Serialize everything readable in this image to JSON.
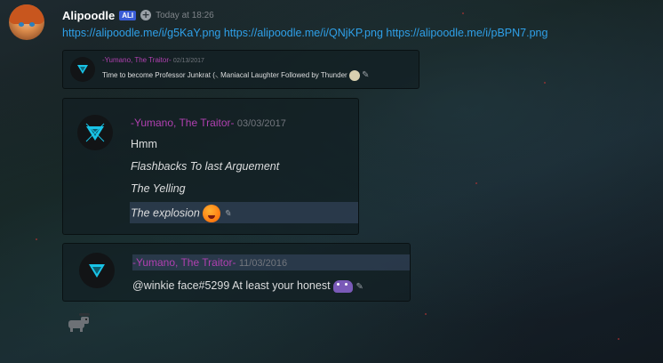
{
  "message": {
    "username": "Alipoodle",
    "badge": "ALI",
    "timestamp": "Today at 18:26",
    "links": [
      "https://alipoodle.me/i/g5KaY.png",
      "https://alipoodle.me/i/QNjKP.png",
      "https://alipoodle.me/i/pBPN7.png"
    ]
  },
  "embeds": [
    {
      "author": "-Yumano, The Traitor-",
      "date": "02/13/2017",
      "lines": [
        "Time to become Professor Junkrat (⸜ Maniacal Laughter Followed by Thunder"
      ]
    },
    {
      "author": "-Yumano, The Traitor-",
      "date": "03/03/2017",
      "lines": [
        "Hmm",
        "Flashbacks To last Arguement",
        "The Yelling",
        "The explosion"
      ]
    },
    {
      "author": "-Yumano, The Traitor-",
      "date": "11/03/2016",
      "lines": [
        "@winkie face#5299 At least your honest"
      ]
    }
  ],
  "colors": {
    "author": "#b040b0",
    "link": "#2fa0e8",
    "logo_cyan": "#19c3e6"
  },
  "icons": [
    "plus-icon",
    "pencil-icon",
    "logo-icon",
    "emoji-icon",
    "pet-icon"
  ]
}
